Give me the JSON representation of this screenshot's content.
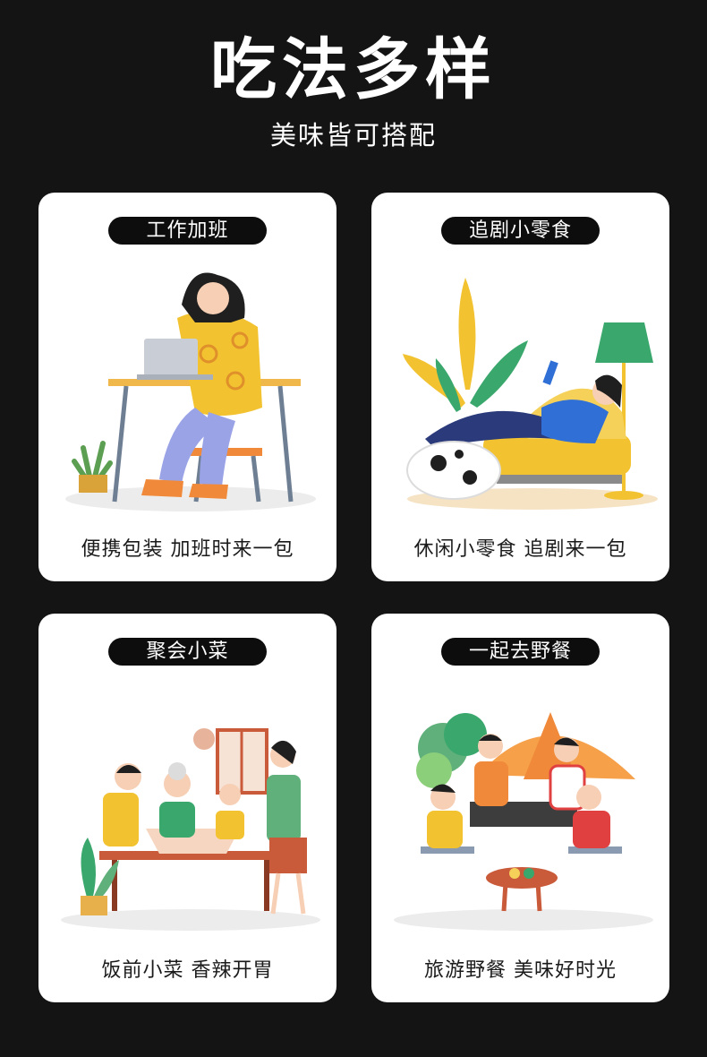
{
  "header": {
    "title": "吃法多样",
    "subtitle": "美味皆可搭配"
  },
  "cards": [
    {
      "tag": "工作加班",
      "caption": "便携包装 加班时来一包"
    },
    {
      "tag": "追剧小零食",
      "caption": "休闲小零食 追剧来一包"
    },
    {
      "tag": "聚会小菜",
      "caption": "饭前小菜 香辣开胃"
    },
    {
      "tag": "一起去野餐",
      "caption": "旅游野餐 美味好时光"
    }
  ],
  "colors": {
    "background": "#141414",
    "card": "#ffffff",
    "pill": "#0d0d0d",
    "accent_yellow": "#f2c230",
    "accent_orange": "#f08a3a",
    "accent_blue": "#2f6fd6",
    "accent_green": "#3aa76d"
  }
}
